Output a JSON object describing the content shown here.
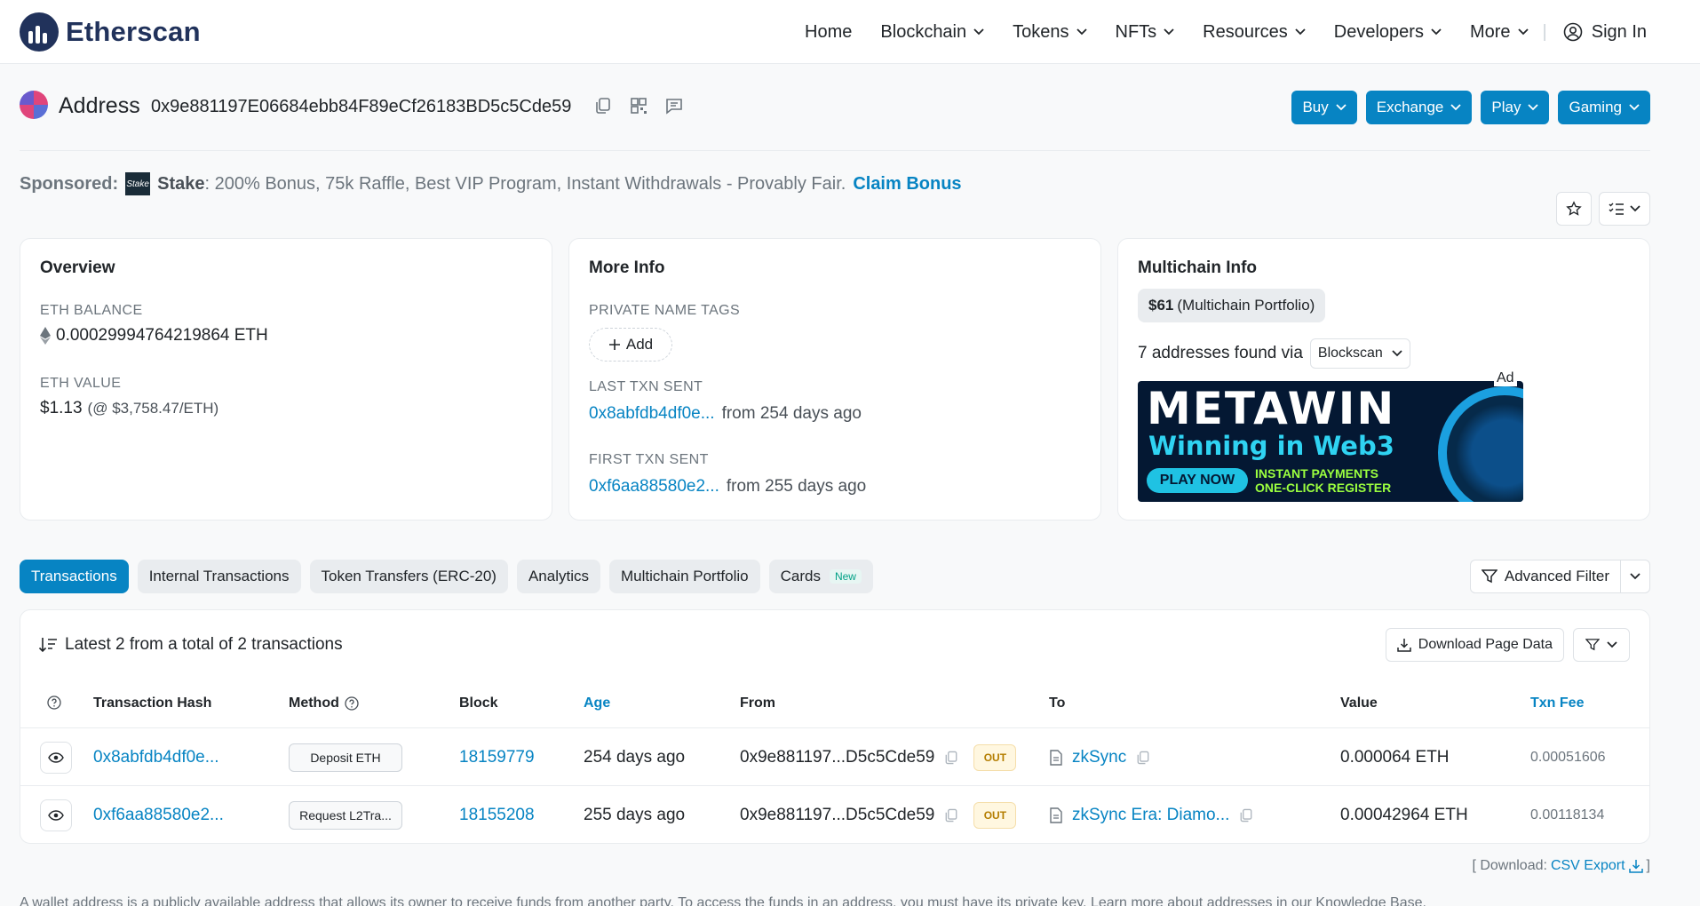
{
  "brand": {
    "name": "Etherscan",
    "logo_icon": "etherscan-logo-icon"
  },
  "nav": {
    "items": [
      {
        "label": "Home",
        "dropdown": false
      },
      {
        "label": "Blockchain",
        "dropdown": true
      },
      {
        "label": "Tokens",
        "dropdown": true
      },
      {
        "label": "NFTs",
        "dropdown": true
      },
      {
        "label": "Resources",
        "dropdown": true
      },
      {
        "label": "Developers",
        "dropdown": true
      },
      {
        "label": "More",
        "dropdown": true
      }
    ],
    "signin": "Sign In"
  },
  "address": {
    "title": "Address",
    "hash": "0x9e881197E06684ebb84F89eCf26183BD5c5Cde59",
    "buttons": [
      "Buy",
      "Exchange",
      "Play",
      "Gaming"
    ]
  },
  "sponsored": {
    "label": "Sponsored:",
    "logo_text": "Stake",
    "name": "Stake",
    "text": ": 200% Bonus, 75k Raffle, Best VIP Program, Instant Withdrawals - Provably Fair.",
    "cta": "Claim Bonus"
  },
  "overview": {
    "title": "Overview",
    "balance_label": "ETH BALANCE",
    "balance": "0.00029994764219864 ETH",
    "value_label": "ETH VALUE",
    "value": "$1.13",
    "value_rate": "(@ $3,758.47/ETH)"
  },
  "more_info": {
    "title": "More Info",
    "tags_label": "PRIVATE NAME TAGS",
    "add_label": "Add",
    "last_label": "LAST TXN SENT",
    "last_hash": "0x8abfdb4df0e...",
    "last_ago": "from 254 days ago",
    "first_label": "FIRST TXN SENT",
    "first_hash": "0xf6aa88580e2...",
    "first_ago": "from 255 days ago"
  },
  "multichain": {
    "title": "Multichain Info",
    "portfolio_value": "$61",
    "portfolio_label": "(Multichain Portfolio)",
    "found": "7 addresses found via",
    "source": "Blockscan",
    "ad_tag": "Ad",
    "ad_brand": "METAWIN",
    "ad_sub": "Winning in Web3",
    "ad_play": "PLAY NOW",
    "ad_line1": "INSTANT PAYMENTS",
    "ad_line2": "ONE-CLICK REGISTER"
  },
  "tabs": [
    {
      "label": "Transactions",
      "active": true
    },
    {
      "label": "Internal Transactions"
    },
    {
      "label": "Token Transfers (ERC-20)"
    },
    {
      "label": "Analytics"
    },
    {
      "label": "Multichain Portfolio"
    },
    {
      "label": "Cards",
      "badge": "New"
    }
  ],
  "advanced_filter": "Advanced Filter",
  "txns": {
    "summary": "Latest 2 from a total of 2 transactions",
    "download": "Download Page Data",
    "headers": {
      "hash": "Transaction Hash",
      "method": "Method",
      "block": "Block",
      "age": "Age",
      "from": "From",
      "to": "To",
      "value": "Value",
      "fee": "Txn Fee"
    },
    "rows": [
      {
        "hash": "0x8abfdb4df0e...",
        "method": "Deposit ETH",
        "block": "18159779",
        "age": "254 days ago",
        "from": "0x9e881197...D5c5Cde59",
        "dir": "OUT",
        "to": "zkSync",
        "value": "0.000064 ETH",
        "fee": "0.00051606"
      },
      {
        "hash": "0xf6aa88580e2...",
        "method": "Request L2Tra...",
        "block": "18155208",
        "age": "255 days ago",
        "from": "0x9e881197...D5c5Cde59",
        "dir": "OUT",
        "to": "zkSync Era: Diamo...",
        "value": "0.00042964 ETH",
        "fee": "0.00118134"
      }
    ]
  },
  "footer": {
    "download_label": "[ Download:",
    "csv": "CSV Export",
    "close": "]"
  },
  "note": "A wallet address is a publicly available address that allows its owner to receive funds from another party. To access the funds in an address, you must have its private key. Learn more about addresses in our Knowledge Base."
}
